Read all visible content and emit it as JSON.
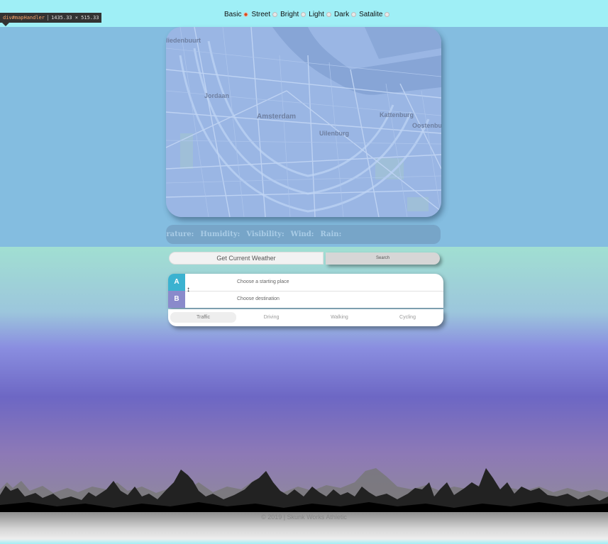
{
  "devtools": {
    "selector": "div#mapHandler",
    "dimensions": "1435.33 × 515.33"
  },
  "map_styles": [
    {
      "label": "Basic",
      "selected": true
    },
    {
      "label": "Street",
      "selected": false
    },
    {
      "label": "Bright",
      "selected": false
    },
    {
      "label": "Light",
      "selected": false
    },
    {
      "label": "Dark",
      "selected": false
    },
    {
      "label": "Satalite",
      "selected": false
    }
  ],
  "map": {
    "labels": [
      "Jordaan",
      "Amsterdam",
      "Kattenburg",
      "Oostenbu",
      "Uilenburg",
      "liedenbuurt"
    ]
  },
  "weather": {
    "fields": [
      "erature:",
      "Humidity:",
      "Visibility:",
      "Wind:",
      "Rain:"
    ]
  },
  "search": {
    "placeholder": "Get Current Weather",
    "button_label": "Search"
  },
  "directions": {
    "origin_badge": "A",
    "destination_badge": "B",
    "origin_placeholder": "Choose a starting place",
    "destination_placeholder": "Choose destination",
    "swap_icon": "↕"
  },
  "profiles": [
    {
      "label": "Traffic",
      "active": true
    },
    {
      "label": "Driving",
      "active": false
    },
    {
      "label": "Walking",
      "active": false
    },
    {
      "label": "Cycling",
      "active": false
    }
  ],
  "footer": "© 2019 | Skunk Works Athletic",
  "colors": {
    "accent_a": "#3bb2d0",
    "accent_b": "#8a8acb",
    "radio_selected": "#d94c1a"
  }
}
